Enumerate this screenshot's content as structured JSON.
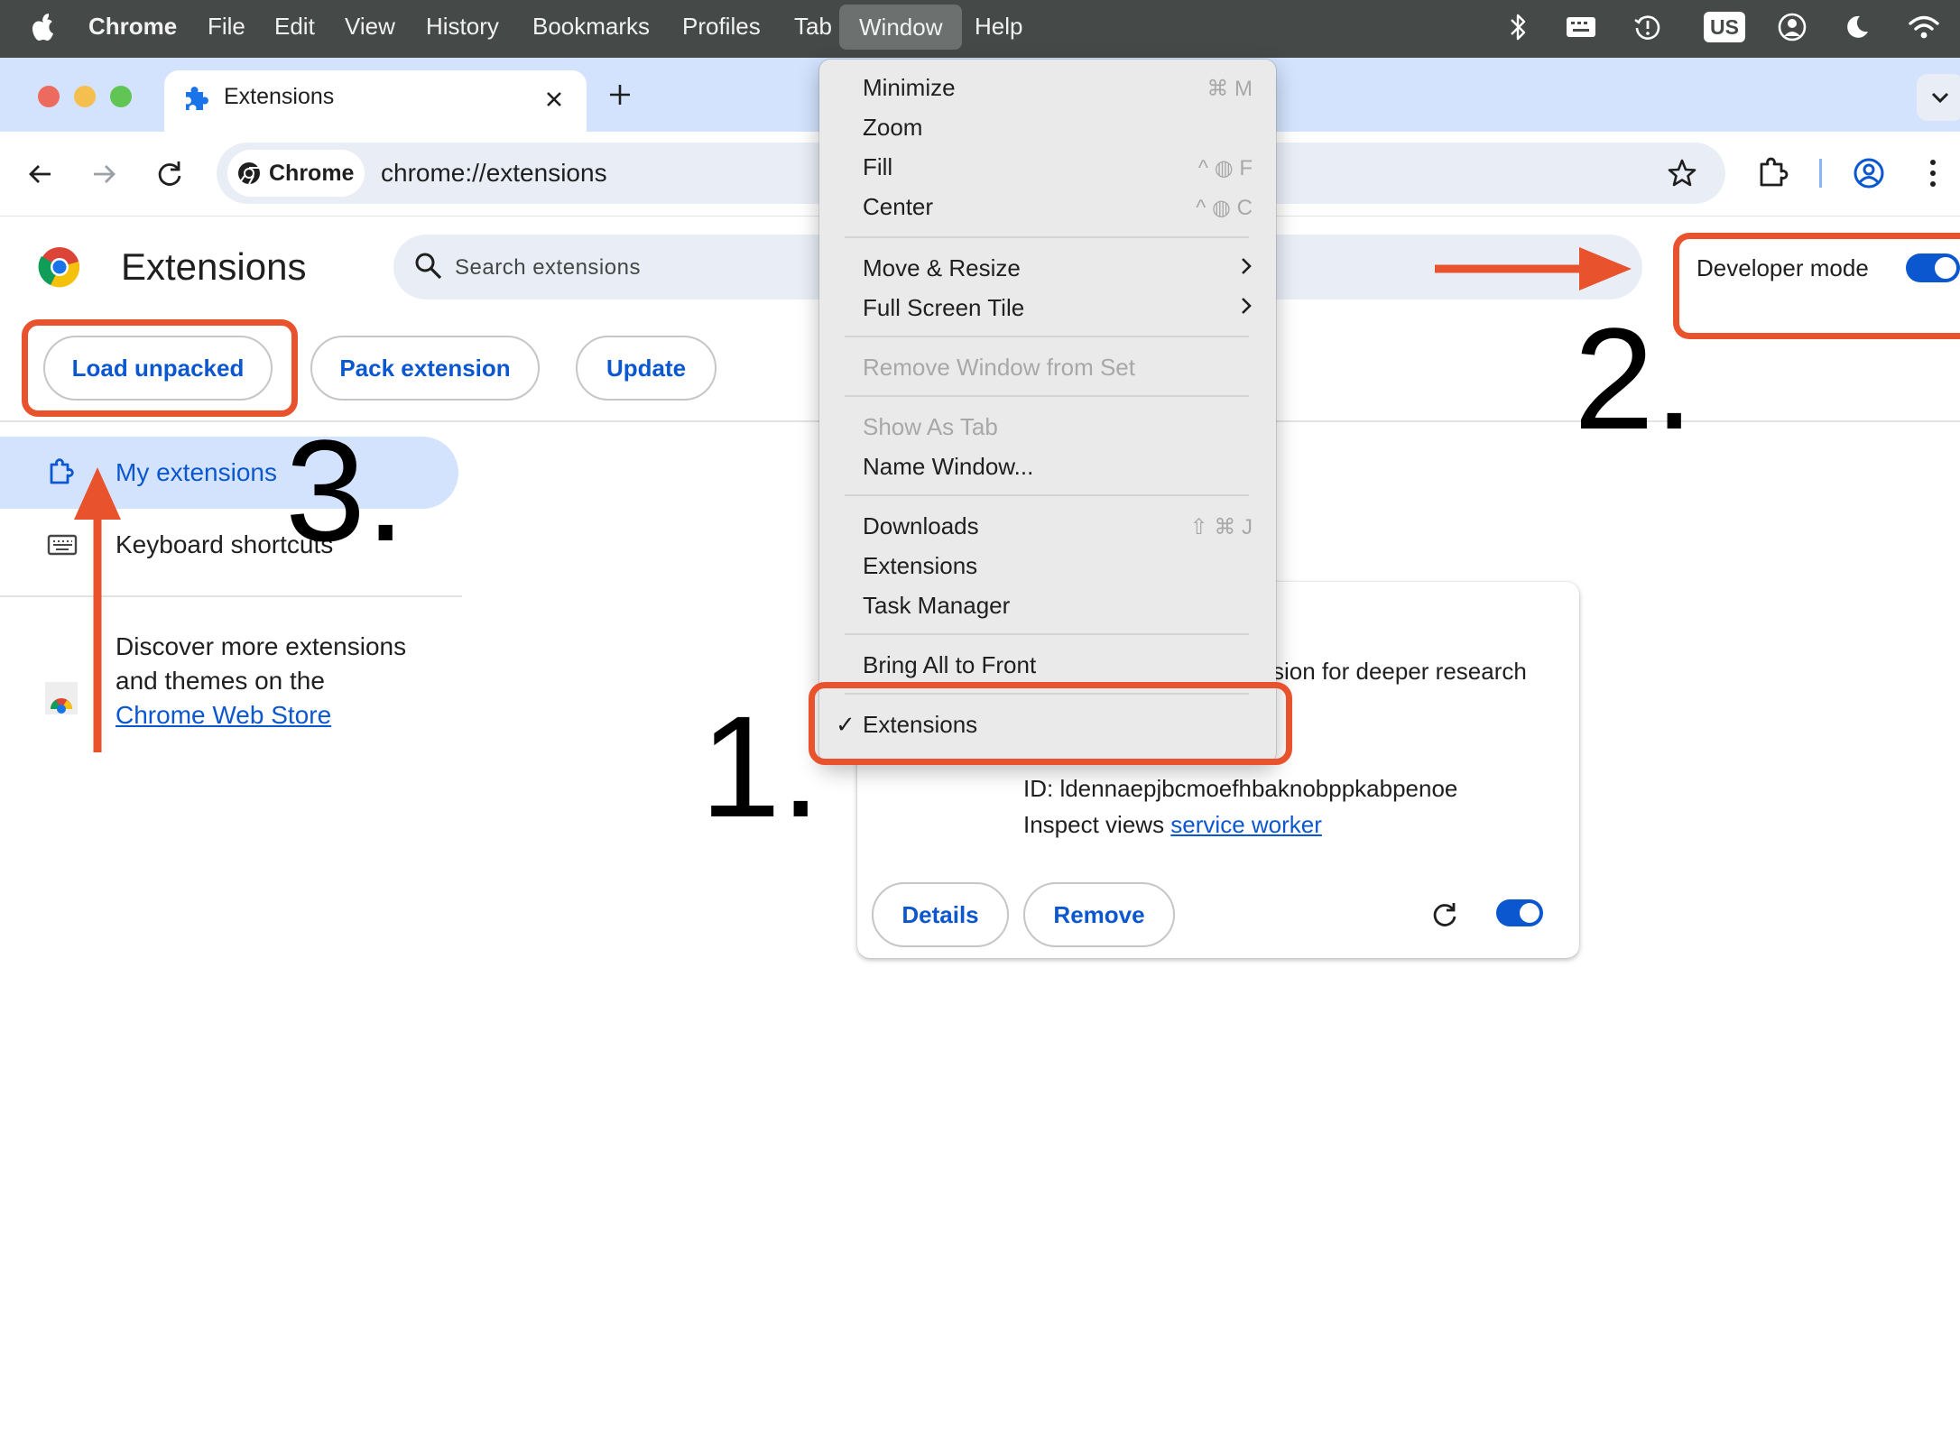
{
  "menubar": {
    "app_name": "Chrome",
    "menus": [
      "File",
      "Edit",
      "View",
      "History",
      "Bookmarks",
      "Profiles",
      "Tab",
      "Window",
      "Help"
    ],
    "input_source": "US"
  },
  "tab": {
    "title": "Extensions"
  },
  "omnibox": {
    "chip_label": "Chrome",
    "url": "chrome://extensions"
  },
  "page": {
    "title": "Extensions",
    "search_placeholder": "Search extensions",
    "developer_mode_label": "Developer mode",
    "buttons": {
      "load_unpacked": "Load unpacked",
      "pack_extension": "Pack extension",
      "update": "Update"
    }
  },
  "sidebar": {
    "items": [
      {
        "label": "My extensions"
      },
      {
        "label": "Keyboard shortcuts"
      }
    ],
    "discover": {
      "prefix": "Discover more extensions and themes on the ",
      "link": "Chrome Web Store"
    }
  },
  "card": {
    "description_fragment": "sion for deeper research",
    "id_text": "ID: ldennaepjbcmoefhbaknobppkabpenoe",
    "inspect_prefix": "Inspect views ",
    "inspect_link": "service worker",
    "details_button": "Details",
    "remove_button": "Remove"
  },
  "window_menu": {
    "items": [
      {
        "label": "Minimize",
        "shortcut": "⌘ M"
      },
      {
        "label": "Zoom"
      },
      {
        "label": "Fill",
        "shortcut": "^ ◍ F"
      },
      {
        "label": "Center",
        "shortcut": "^ ◍ C"
      },
      {
        "label": "Move & Resize",
        "submenu": true
      },
      {
        "label": "Full Screen Tile",
        "submenu": true
      },
      {
        "label": "Remove Window from Set",
        "disabled": true
      },
      {
        "label": "Show As Tab",
        "disabled": true
      },
      {
        "label": "Name Window..."
      },
      {
        "label": "Downloads",
        "shortcut": "⇧ ⌘ J"
      },
      {
        "label": "Extensions"
      },
      {
        "label": "Task Manager"
      },
      {
        "label": "Bring All to Front"
      },
      {
        "label": "Extensions",
        "checked": true
      }
    ],
    "check_mark": "✓"
  },
  "annotations": {
    "step1": "1.",
    "step2": "2.",
    "step3": "3.",
    "color": "#e8522c"
  },
  "colors": {
    "accent": "#0b57d0",
    "menubar": "#454a48",
    "tabstrip": "#d3e3fd"
  }
}
